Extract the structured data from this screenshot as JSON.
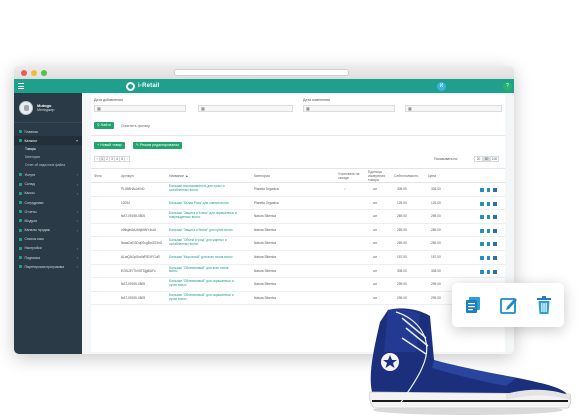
{
  "app": {
    "logo_text": "i-Retail",
    "top_icons": [
      "user-icon",
      "help-icon"
    ]
  },
  "profile": {
    "name": "Mutogo",
    "role": "Менеджер"
  },
  "colors": {
    "brand": "#1fa08c",
    "sidebar": "#2a3a47",
    "action_button": "#22a56d",
    "link": "#1a9e8b",
    "icon_blue": "#1f8fc5"
  },
  "sidebar": {
    "items": [
      {
        "label": "Главная",
        "icon": "home-icon",
        "arrow": ""
      },
      {
        "label": "Каталог",
        "icon": "catalog-icon",
        "arrow": "▾",
        "active": true
      },
      {
        "label": "Услуги",
        "icon": "services-icon",
        "arrow": "›"
      },
      {
        "label": "Склад",
        "icon": "warehouse-icon",
        "arrow": "›"
      },
      {
        "label": "Кассы",
        "icon": "cashbox-icon",
        "arrow": "›"
      },
      {
        "label": "Сотрудники",
        "icon": "staff-icon",
        "arrow": ""
      },
      {
        "label": "Отчеты",
        "icon": "reports-icon",
        "arrow": "›"
      },
      {
        "label": "Модули",
        "icon": "modules-icon",
        "arrow": "›"
      },
      {
        "label": "Каналы продаж",
        "icon": "sales-icon",
        "arrow": "›"
      },
      {
        "label": "Список касс",
        "icon": "list-icon",
        "arrow": ""
      },
      {
        "label": "Настройки",
        "icon": "settings-icon",
        "arrow": "›"
      },
      {
        "label": "Подписка",
        "icon": "subscription-icon",
        "arrow": "›"
      },
      {
        "label": "Партнерская программа",
        "icon": "partner-icon",
        "arrow": "›"
      }
    ],
    "sub_items": [
      {
        "label": "Товары",
        "current": true
      },
      {
        "label": "Категории",
        "current": false
      },
      {
        "label": "Отчет об недостаче файла",
        "current": false
      }
    ]
  },
  "filters": {
    "date_added_label": "Дата добавления",
    "date_changed_label": "Дата изменения",
    "find_button": "Найти",
    "clear_link": "Очистить фильтр"
  },
  "toolbar": {
    "new_product": "Новый товар",
    "edit_mode": "Режим редактирования"
  },
  "pagination": {
    "pages": [
      "‹",
      "1",
      "2",
      "3",
      "4",
      "5",
      "›"
    ],
    "current_page": "1",
    "show_label": "Показывать по:",
    "per_page": [
      "20",
      "50",
      "100"
    ],
    "per_page_selected": "50"
  },
  "table": {
    "headers": {
      "photo": "Фото",
      "article": "Артикул",
      "name": "Название ▲",
      "category": "Категория",
      "stock": "Учитывать на складе",
      "unit": "Единица измерения товара",
      "cost": "Себестоимость",
      "price": "Цена"
    },
    "rows": [
      {
        "article": "PL098HALM040",
        "name": "Бальзам-ополаскиватель для сухих и ослабленных волос",
        "category": "Planeta Organica",
        "stock": "✓",
        "unit": "шт",
        "cost": "305.00",
        "price": "305.00"
      },
      {
        "article": "12094",
        "name": "Бальзам \"Белая Роза\" для сияния волос",
        "category": "Planeta Organica",
        "stock": "",
        "unit": "шт",
        "cost": "125.00",
        "price": "125.00"
      },
      {
        "article": "NAT-09198-0805",
        "name": "Бальзам \"Защита и Блеск\" для окрашенных и поврежденных волос",
        "category": "Natura Siberica",
        "stock": "",
        "unit": "шт",
        "cost": "269.00",
        "price": "269.00"
      },
      {
        "article": "c98sjasfoUAhjb5NY4sUt",
        "name": "Бальзам \"Защита и блеск\" для сухих волос",
        "category": "Natura Siberica",
        "stock": "",
        "unit": "шт",
        "cost": "269.00",
        "price": "269.00"
      },
      {
        "article": "NsasDxG3Dq0SvgBoGS3nG",
        "name": "Бальзам \"Объем и уход\" для жирных и ослабленных волос",
        "category": "Natura Siberica",
        "stock": "",
        "unit": "шт",
        "cost": "269.00",
        "price": "269.00"
      },
      {
        "article": "ALiaQfL0pSxcWFiEXFGuR",
        "name": "Бальзам \"Морозный\" для всех типов волос",
        "category": "Natura Siberica",
        "stock": "",
        "unit": "шт",
        "cost": "157.00",
        "price": "157.00"
      },
      {
        "article": "EGNJ3Y7hV5TSjg8IAFc",
        "name": "Бальзам \"Облепиховый\" для всех типов волос",
        "category": "Natura Siberica",
        "stock": "",
        "unit": "шт",
        "cost": "308.00",
        "price": "308.00"
      },
      {
        "article": "NAT-09195-0805",
        "name": "Бальзам \"Облепиховый\" для окрашенных и сухих волос",
        "category": "Natura Siberica",
        "stock": "",
        "unit": "шт",
        "cost": "299.00",
        "price": "299.00"
      },
      {
        "article": "NAT-09195-0805",
        "name": "Бальзам \"Облепиховый\" для окрашенных и сухих волос",
        "category": "Natura Siberica",
        "stock": "",
        "unit": "шт",
        "cost": "299.00",
        "price": "299.00"
      }
    ]
  },
  "popup_actions": [
    "copy-icon",
    "edit-icon",
    "delete-icon"
  ]
}
